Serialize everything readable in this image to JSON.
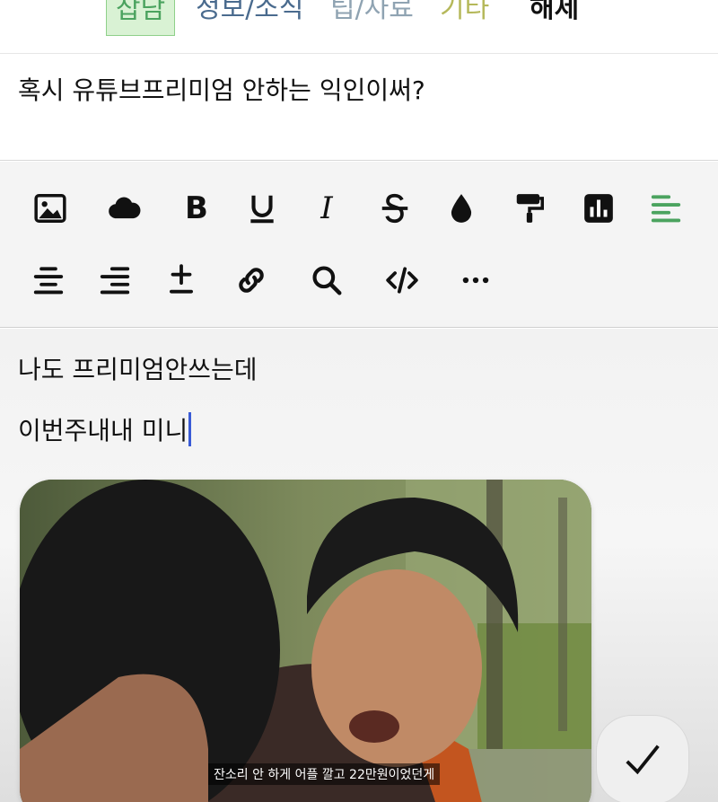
{
  "tabs": {
    "chat": "잡담",
    "info": "정보/소식",
    "tip": "팁/자료",
    "etc": "기타",
    "release": "해제"
  },
  "post": {
    "title": "혹시 유튜브프리미엄 안하는 익인이써?"
  },
  "toolbar": {
    "row1": [
      "image-icon",
      "cloud-icon",
      "bold-icon",
      "underline-icon",
      "italic-icon",
      "strikethrough-icon",
      "color-drop-icon",
      "paint-roller-icon",
      "chart-icon",
      "align-left-icon"
    ],
    "row2": [
      "align-center-icon",
      "align-right-icon",
      "plus-minus-icon",
      "link-icon",
      "search-icon",
      "code-icon",
      "more-icon"
    ],
    "bold_label": "B",
    "italic_label": "I",
    "active_color": "#4ba35f"
  },
  "body": {
    "line1": "나도 프리미엄안쓰는데",
    "line2": "이번주내내 미니"
  },
  "image": {
    "caption": "잔소리 안 하게 어플 깔고 22만원이었던게"
  },
  "confirm_icon": "checkmark-icon"
}
